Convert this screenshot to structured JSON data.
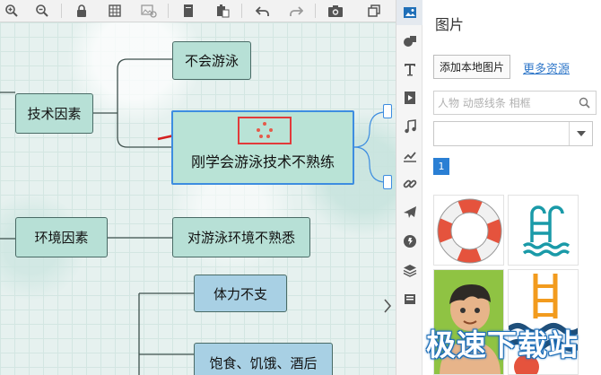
{
  "toolbar": {
    "icons": [
      "zoom-in-icon",
      "zoom-out-icon",
      "lock-icon",
      "grid-icon",
      "image-settings-icon",
      "new-page-icon",
      "paste-icon",
      "undo-icon",
      "redo-icon",
      "camera-icon",
      "window-icon"
    ]
  },
  "mindmap": {
    "factor_tech": "技术因素",
    "sub_cant_swim": "不会游泳",
    "sub_just_learned": "刚学会游泳技术不熟练",
    "factor_env": "环境因素",
    "sub_env_unfamiliar": "对游泳环境不熟悉",
    "sub_stamina": "体力不支",
    "sub_food": "饱食、饥饿、酒后"
  },
  "panel": {
    "title": "图片",
    "add_local_button": "添加本地图片",
    "more_resources_link": "更多资源",
    "search_placeholder": "人物 动感线条 相框",
    "category_value": "",
    "page_current": "1",
    "thumbnails": [
      "lifebuoy-image",
      "pool-ladder-image",
      "swimmer-boy-image",
      "ladder-waves-image"
    ]
  },
  "watermark": "极速下载站",
  "colors": {
    "node_teal": "#b7e0d6",
    "node_blue": "#a8d0e4",
    "selection": "#3d8de0",
    "accent_link": "#2f77c9",
    "page_active": "#2a7fd4",
    "highlight_red": "#e23a3a"
  }
}
